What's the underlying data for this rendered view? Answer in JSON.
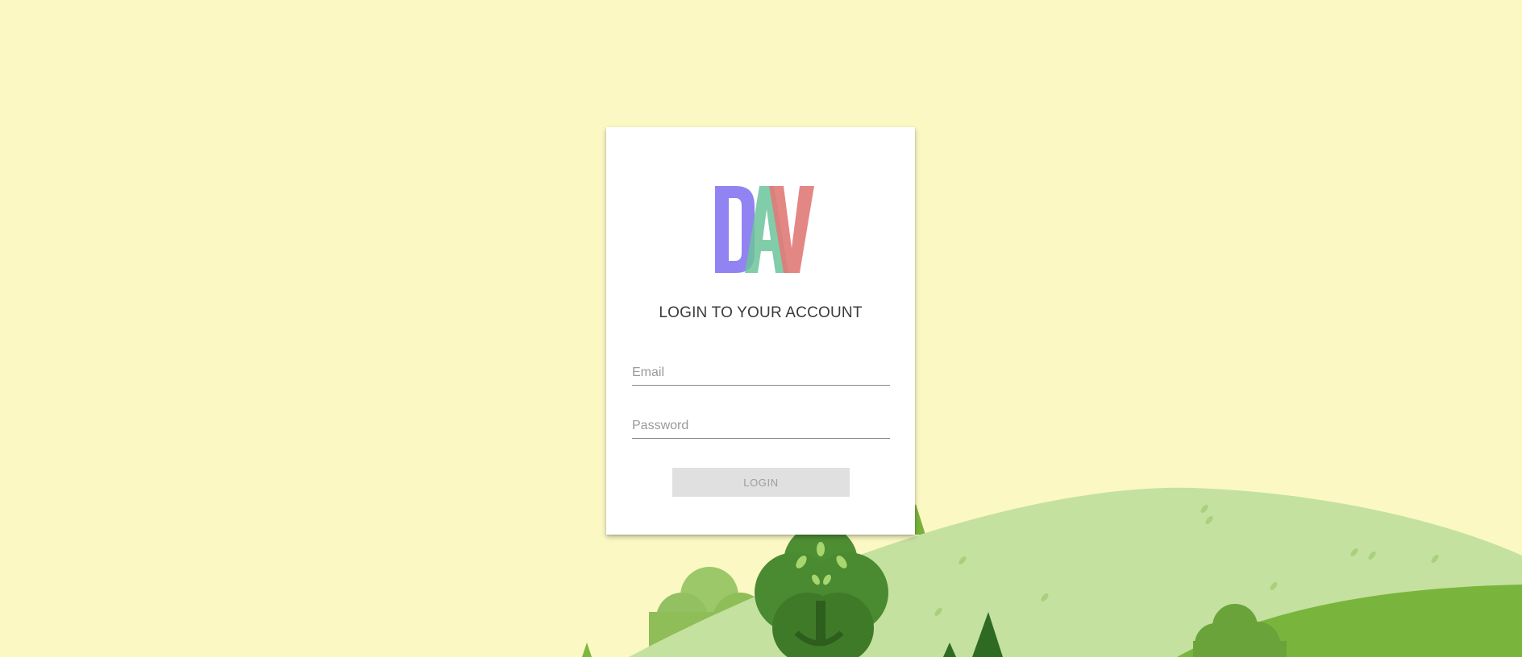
{
  "logo": {
    "text": "DAV",
    "colors": [
      "#8c7cf2",
      "#6cc49a",
      "#e07a78"
    ]
  },
  "login": {
    "title": "LOGIN TO YOUR ACCOUNT",
    "email_placeholder": "Email",
    "email_value": "",
    "password_placeholder": "Password",
    "password_value": "",
    "button_label": "LOGIN"
  },
  "colors": {
    "background": "#fbf8c4",
    "card": "#ffffff",
    "button_disabled": "#e0e0e0",
    "hill_light": "#c4e1a0",
    "hill_mid": "#79b53c",
    "tree_dark": "#3f7a29",
    "bush": "#8fbd57"
  }
}
